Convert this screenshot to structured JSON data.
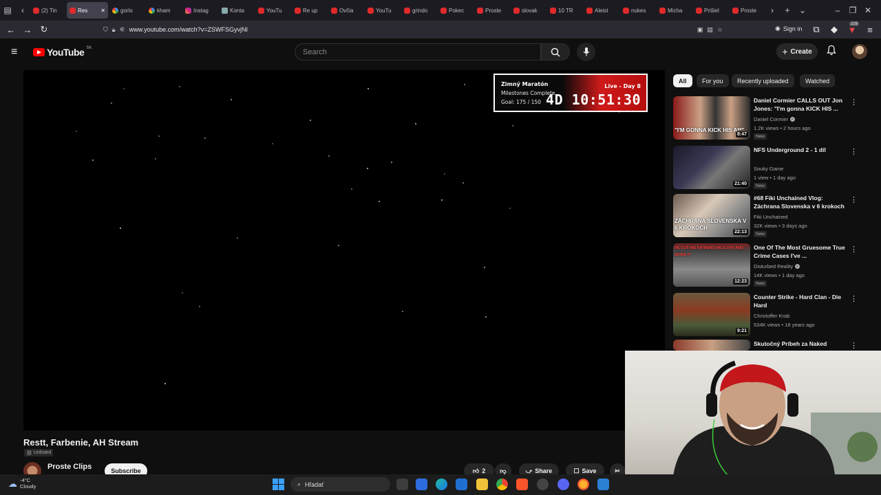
{
  "browser": {
    "tabs": [
      {
        "label": "(2) Tin",
        "icon": "tinder-icon"
      },
      {
        "label": "Res",
        "icon": "youtube-icon",
        "active": true
      },
      {
        "label": "gorlo",
        "icon": "google-icon"
      },
      {
        "label": "kham",
        "icon": "google-icon"
      },
      {
        "label": "Instag",
        "icon": "instagram-icon"
      },
      {
        "label": "Konta",
        "icon": "mail-icon"
      },
      {
        "label": "YouTu",
        "icon": "youtube-icon"
      },
      {
        "label": "Re up",
        "icon": "youtube-icon"
      },
      {
        "label": "Ovčia",
        "icon": "youtube-icon"
      },
      {
        "label": "YouTu",
        "icon": "youtube-icon"
      },
      {
        "label": "grindo",
        "icon": "youtube-icon"
      },
      {
        "label": "Pokec",
        "icon": "youtube-icon"
      },
      {
        "label": "Proste",
        "icon": "youtube-icon"
      },
      {
        "label": "slovak",
        "icon": "youtube-icon"
      },
      {
        "label": "10 TR",
        "icon": "youtube-icon"
      },
      {
        "label": "Aleist",
        "icon": "youtube-icon"
      },
      {
        "label": "nukes",
        "icon": "youtube-icon"
      },
      {
        "label": "Micha",
        "icon": "youtube-icon"
      },
      {
        "label": "Prišiel",
        "icon": "youtube-icon"
      },
      {
        "label": "Proste",
        "icon": "youtube-icon"
      }
    ],
    "url": "www.youtube.com/watch?v=ZSWFSGyvjNI",
    "sign_in": "Sign in",
    "badge_count": "229"
  },
  "youtube": {
    "logo_text": "YouTube",
    "region": "SK",
    "search_placeholder": "Search",
    "create_label": "Create",
    "video": {
      "title": "Restt, Farbenie, AH Stream",
      "visibility": "Unlisted",
      "channel": "Proste Clips",
      "subscribe_label": "Subscribe",
      "likes": "2",
      "share_label": "Share",
      "save_label": "Save"
    },
    "stream_overlay": {
      "title": "Zimný Maratón",
      "milestones": "Milestones Complete",
      "goal": "Goal: 175 / 150",
      "live": "Live - Day 8",
      "timer": "4D 10:51:30"
    },
    "chips": [
      "All",
      "For you",
      "Recently uploaded",
      "Watched"
    ],
    "recommendations": [
      {
        "title": "Daniel Cormier CALLS OUT Jon Jones: \"I'm gonna KICK HIS ...",
        "channel": "Daniel Cormier",
        "verified": true,
        "meta": "1.2K views • 2 hours ago",
        "duration": "8:47",
        "badge": "New",
        "thumb_text": "\"I'M GONNA KICK HIS A**\""
      },
      {
        "title": "NFS Underground 2 - 1 díl",
        "channel": "Souky Game",
        "verified": false,
        "meta": "1 view • 1 day ago",
        "duration": "21:40",
        "badge": "New",
        "thumb_text": ""
      },
      {
        "title": "#68 Fiki Unchained Vlog: Záchrana Slovenska v 6 krokoch",
        "channel": "Fiki Unchained",
        "verified": false,
        "meta": "32K views • 3 days ago",
        "duration": "22:13",
        "badge": "New",
        "thumb_text": "ZÁCHRANA SLOVENSKA V 6 KROKOCH"
      },
      {
        "title": "One Of The Most Gruesome True Crime Cases I've ...",
        "channel": "Disturbed Reality",
        "verified": true,
        "meta": "14K views • 1 day ago",
        "duration": "12:23",
        "badge": "New",
        "thumb_text": "HE CUT HIS FATHERS FACE OFF AND WORE IT"
      },
      {
        "title": "Counter Strike - Hard Clan - Die Hard",
        "channel": "Christoffer Krab",
        "verified": false,
        "meta": "534K views • 18 years ago",
        "duration": "9:21",
        "badge": "",
        "thumb_text": ""
      },
      {
        "title": "Skutočný Príbeh za Naked",
        "channel": "",
        "verified": false,
        "meta": "",
        "duration": "",
        "badge": "",
        "thumb_text": ""
      }
    ]
  },
  "taskbar": {
    "weather_temp": "-4°C",
    "weather_desc": "Cloudy",
    "search_placeholder": "Hľadať"
  },
  "colors": {
    "yt_red": "#ff0000",
    "overlay_red": "#d01a1a",
    "bg": "#0f0f0f"
  }
}
